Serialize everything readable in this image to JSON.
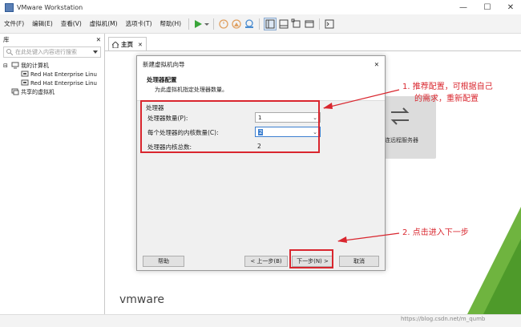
{
  "window": {
    "title": "VMware Workstation",
    "minimize": "—",
    "maximize": "☐",
    "close": "✕"
  },
  "menu": [
    "文件(F)",
    "编辑(E)",
    "查看(V)",
    "虚拟机(M)",
    "选项卡(T)",
    "帮助(H)"
  ],
  "sidebar": {
    "header": "库",
    "close": "✕",
    "search_placeholder": "在此处键入内容进行搜索",
    "tree": [
      {
        "label": "我的计算机",
        "level": 0
      },
      {
        "label": "Red Hat Enterprise Linu",
        "level": 1
      },
      {
        "label": "Red Hat Enterprise Linu",
        "level": 1
      },
      {
        "label": "共享的虚拟机",
        "level": 0
      }
    ]
  },
  "main": {
    "tab_label": "主页",
    "tab_close": "✕",
    "remote_label": "连远程服务器",
    "logo": "vmware"
  },
  "dialog": {
    "title": "新建虚拟机向导",
    "close": "✕",
    "heading": "处理器配置",
    "subheading": "为此虚拟机指定处理器数量。",
    "group_title": "处理器",
    "processor_count_label": "处理器数量(P):",
    "processor_count_value": "1",
    "cores_label": "每个处理器的内核数量(C):",
    "cores_value": "2",
    "total_label": "处理器内核总数:",
    "total_value": "2",
    "help_button": "帮助",
    "back_button": "< 上一步(B)",
    "next_button": "下一步(N) >",
    "cancel_button": "取消"
  },
  "annotations": {
    "note1_line1": "1. 推荐配置，可根据自己",
    "note1_line2": "的需求，重新配置",
    "note2": "2. 点击进入下一步"
  },
  "watermark": "https://blog.csdn.net/m_qumb",
  "colors": {
    "accent_red": "#d9262e",
    "play_green": "#3aa53a",
    "vmware_green": "#6fb43f"
  }
}
